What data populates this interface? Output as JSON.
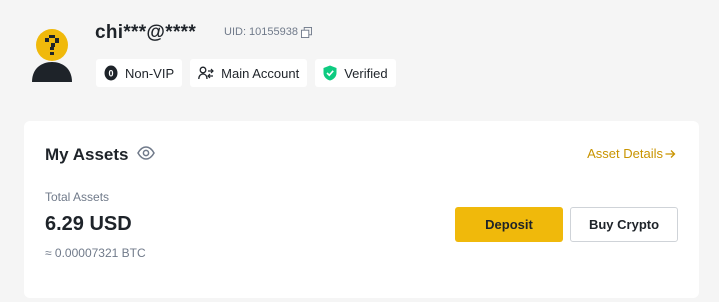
{
  "profile": {
    "username": "chi***@****",
    "uid": "UID: 10155938",
    "badges": [
      {
        "icon": "vip-level-icon",
        "label": "Non-VIP"
      },
      {
        "icon": "account-switch-icon",
        "label": "Main Account"
      },
      {
        "icon": "verified-shield-icon",
        "label": "Verified"
      }
    ]
  },
  "assets": {
    "title": "My Assets",
    "details_link": "Asset Details",
    "total_label": "Total Assets",
    "total_value": "6.29 USD",
    "btc_value": "≈ 0.00007321 BTC",
    "deposit_label": "Deposit",
    "buy_label": "Buy Crypto"
  },
  "colors": {
    "accent": "#f0b90b",
    "link": "#c99400",
    "verified": "#0ecb81",
    "background": "#f5f5f5"
  }
}
